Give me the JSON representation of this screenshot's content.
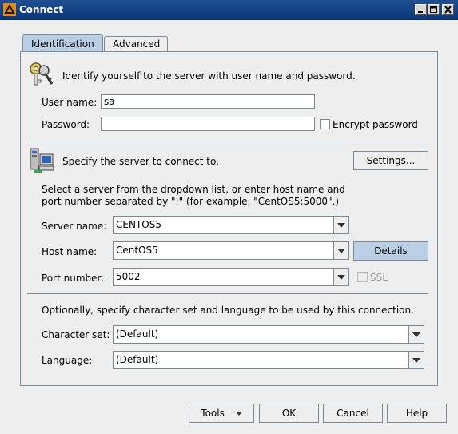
{
  "window": {
    "title": "Connect",
    "controls": [
      "minimize",
      "maximize",
      "close"
    ]
  },
  "tabs": [
    {
      "label": "Identification",
      "selected": true
    },
    {
      "label": "Advanced",
      "selected": false
    }
  ],
  "identification": {
    "intro": "Identify yourself to the server with user name and password.",
    "user_name_label": "User name:",
    "user_name_value": "sa",
    "password_label": "Password:",
    "password_value": "",
    "encrypt_label": "Encrypt password",
    "encrypt_checked": false
  },
  "server": {
    "intro": "Specify the server to connect to.",
    "settings_button": "Settings...",
    "instructions_line1": "Select a server from the dropdown list, or enter host name and",
    "instructions_line2": "port number separated by \":\" (for example, \"CentOS5:5000\".)",
    "server_name_label": "Server name:",
    "server_name_value": "CENTOS5",
    "host_name_label": "Host name:",
    "host_name_value": "CentOS5",
    "details_button": "Details",
    "port_label": "Port number:",
    "port_value": "5002",
    "ssl_label": "SSL",
    "ssl_checked": false,
    "ssl_enabled": false
  },
  "charset": {
    "intro": "Optionally, specify character set and language to be used by this connection.",
    "charset_label": "Character set:",
    "charset_value": "(Default)",
    "language_label": "Language:",
    "language_value": "(Default)"
  },
  "footer": {
    "tools_button": "Tools",
    "ok_button": "OK",
    "cancel_button": "Cancel",
    "help_button": "Help"
  },
  "icons": {
    "app": "sybase-app-icon",
    "keys": "keys-icon",
    "server": "server-computer-icon",
    "dropdown": "chevron-down-icon"
  },
  "colors": {
    "title_bar": "#1f4f93",
    "selected_tab": "#b8cfe5",
    "accent_button": "#b8cfe5",
    "background": "#eeeeee"
  }
}
